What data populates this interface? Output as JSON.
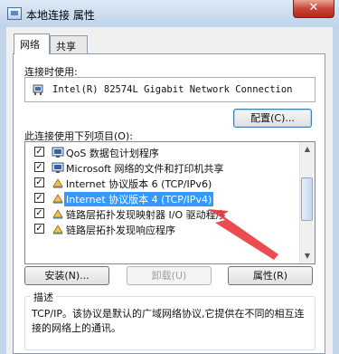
{
  "window": {
    "title": "本地连接 属性",
    "close_label": "✕"
  },
  "tabs": [
    {
      "label": "网络"
    },
    {
      "label": "共享"
    }
  ],
  "connect_using": {
    "label": "连接时使用:",
    "adapter": "Intel(R) 82574L Gigabit Network Connection",
    "configure_button": "配置(C)..."
  },
  "items_section": {
    "label": "此连接使用下列项目(O):",
    "items": [
      {
        "label": "QoS 数据包计划程序",
        "checked": true,
        "icon": "qos-icon"
      },
      {
        "label": "Microsoft 网络的文件和打印机共享",
        "checked": true,
        "icon": "share-icon"
      },
      {
        "label": "Internet 协议版本 6 (TCP/IPv6)",
        "checked": true,
        "icon": "protocol-icon"
      },
      {
        "label": "Internet 协议版本 4 (TCP/IPv4)",
        "checked": true,
        "icon": "protocol-icon",
        "selected": true
      },
      {
        "label": "链路层拓扑发现映射器 I/O 驱动程序",
        "checked": true,
        "icon": "protocol-icon"
      },
      {
        "label": "链路层拓扑发现响应程序",
        "checked": true,
        "icon": "protocol-icon"
      }
    ]
  },
  "buttons": {
    "install": "安装(N)...",
    "uninstall": "卸载(U)",
    "properties": "属性(R)"
  },
  "description": {
    "legend": "描述",
    "text": "TCP/IP。该协议是默认的广域网络协议,它提供在不同的相互连接的网络上的通讯。"
  },
  "colors": {
    "selection": "#3399ff",
    "annotation_arrow": "#e8383d"
  }
}
